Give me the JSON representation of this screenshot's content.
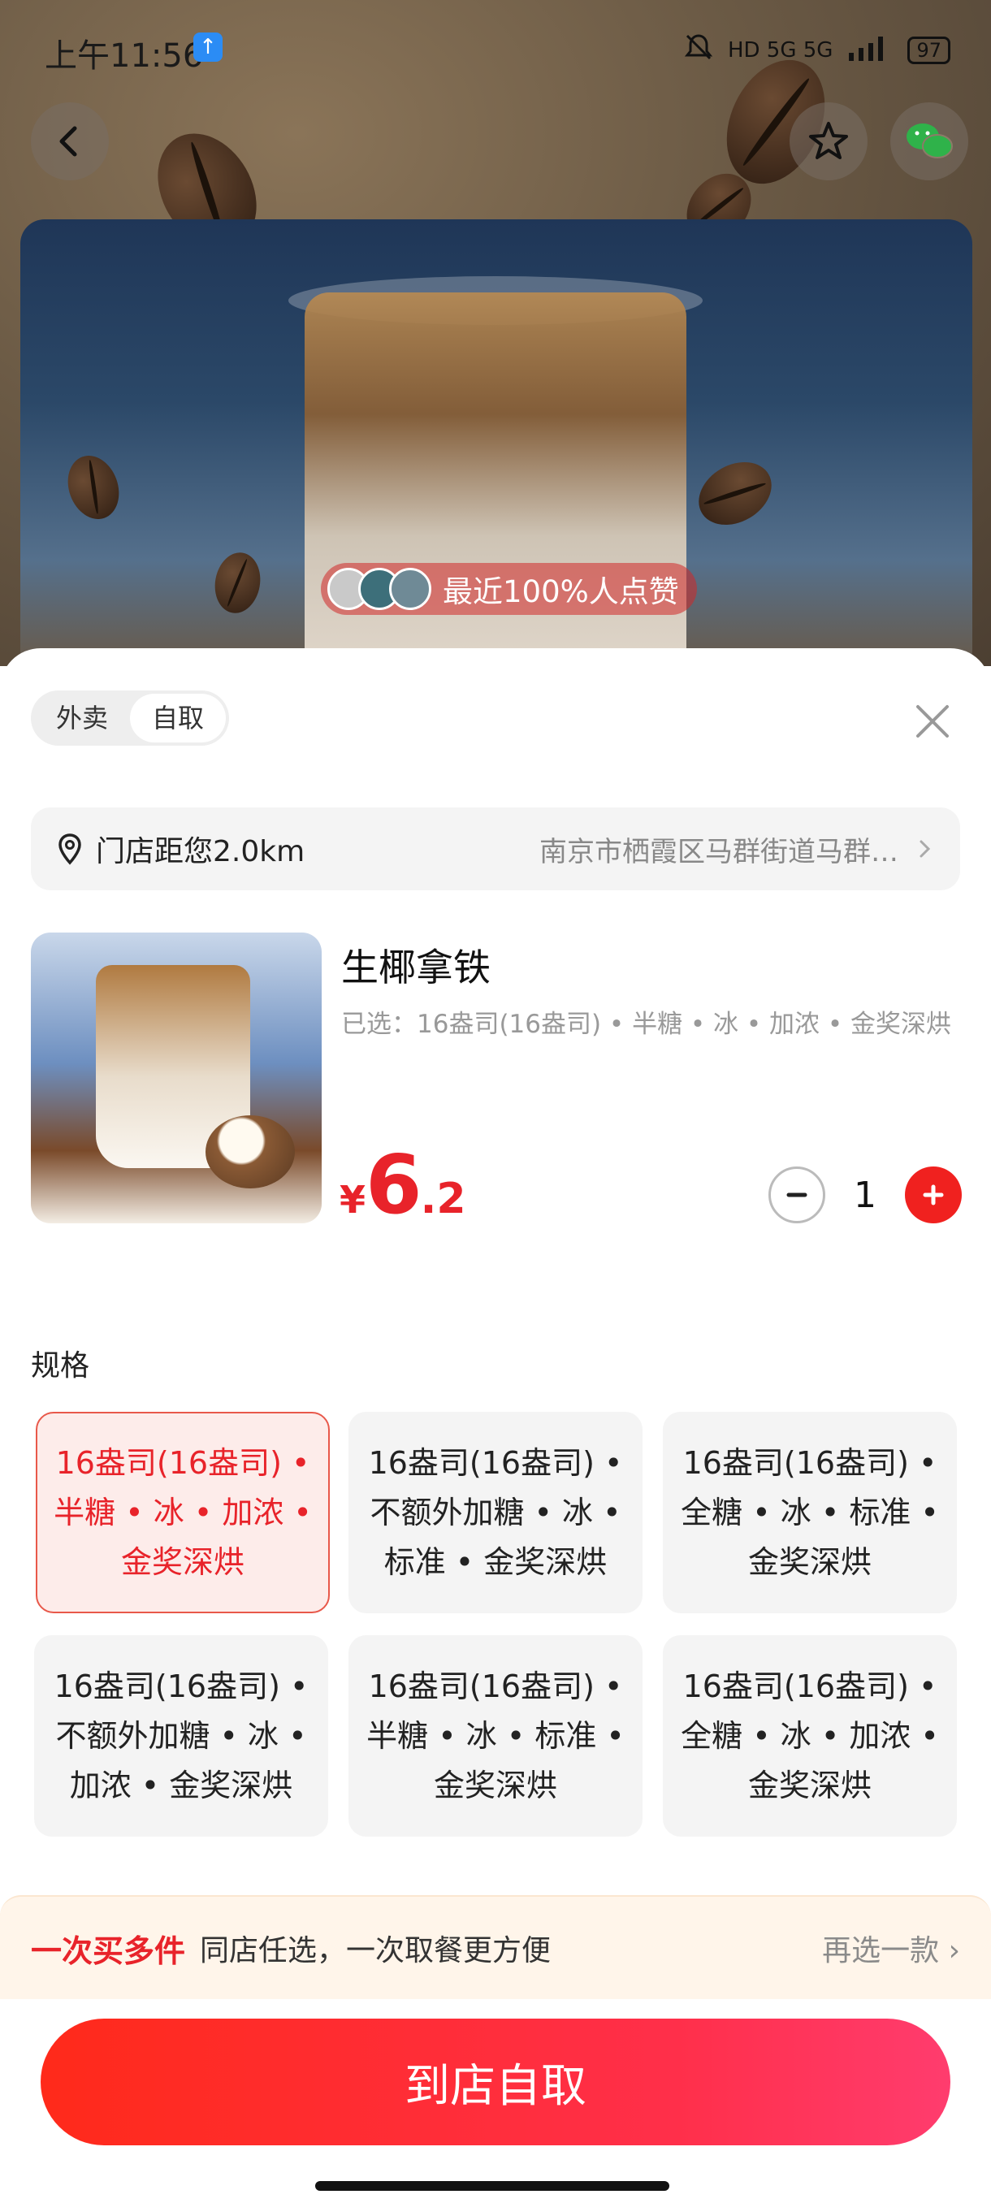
{
  "status_bar": {
    "time": "上午11:56",
    "network": "HD 5G 5G",
    "battery": "97"
  },
  "hero": {
    "likes_text": "最近100%人点赞"
  },
  "fulfillment_tabs": [
    {
      "label": "外卖",
      "active": false
    },
    {
      "label": "自取",
      "active": true
    }
  ],
  "store": {
    "distance": "门店距您2.0km",
    "address": "南京市栖霞区马群街道马群…"
  },
  "product": {
    "name": "生椰拿铁",
    "selected": "已选：16盎司(16盎司) • 半糖 • 冰 • 加浓 • 金奖深烘",
    "price_currency": "¥",
    "price_int": "6",
    "price_dec": ".2",
    "quantity": "1"
  },
  "spec": {
    "title": "规格",
    "options": [
      {
        "label": "16盎司(16盎司) • 半糖 • 冰 • 加浓 • 金奖深烘",
        "selected": true
      },
      {
        "label": "16盎司(16盎司) • 不额外加糖 • 冰 • 标准 • 金奖深烘",
        "selected": false
      },
      {
        "label": "16盎司(16盎司) • 全糖 • 冰 • 标准 • 金奖深烘",
        "selected": false
      },
      {
        "label": "16盎司(16盎司) • 不额外加糖 • 冰 • 加浓 • 金奖深烘",
        "selected": false
      },
      {
        "label": "16盎司(16盎司) • 半糖 • 冰 • 标准 • 金奖深烘",
        "selected": false
      },
      {
        "label": "16盎司(16盎司) • 全糖 • 冰 • 加浓 • 金奖深烘",
        "selected": false
      }
    ]
  },
  "banner": {
    "strong": "一次买多件",
    "text": "同店任选，一次取餐更方便",
    "link": "再选一款"
  },
  "cta": {
    "label": "到店自取"
  },
  "colors": {
    "accent": "#e8232a",
    "cta_start": "#ff2a1a",
    "cta_end": "#ff3c6e"
  }
}
